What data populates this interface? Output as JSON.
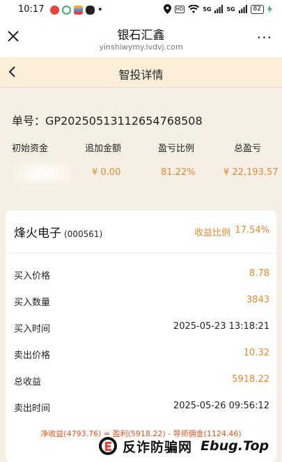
{
  "status_bar": {
    "time": "10:17",
    "network_badge": "HD",
    "signal_1": "5G",
    "signal_2": "5G",
    "battery": "82",
    "dot": "•"
  },
  "browser": {
    "title": "银石汇鑫",
    "url": "yinshiwymy.lvdvj.com",
    "more": "···"
  },
  "header": {
    "title": "智投详情"
  },
  "summary": {
    "order_label": "单号：",
    "order_no": "GP20250513112654768508",
    "headers": [
      "初始资金",
      "追加金额",
      "盈亏比例",
      "总盈亏"
    ],
    "values": {
      "initial": "",
      "added": "¥ 0.00",
      "pl_ratio": "81.22%",
      "total_pl": "¥ 22,193.57"
    }
  },
  "card": {
    "stock_name": "烽火电子",
    "stock_code": "(000561)",
    "yield_label": "收益比例",
    "yield_value": "17.54%",
    "rows": [
      {
        "label": "买入价格",
        "value": "8.78"
      },
      {
        "label": "买入数量",
        "value": "3843"
      },
      {
        "label": "买入时间",
        "value": "2025-05-23 13:18:21"
      },
      {
        "label": "卖出价格",
        "value": "10.32"
      },
      {
        "label": "总收益",
        "value": "5918.22"
      },
      {
        "label": "卖出时间",
        "value": "2025-05-26 09:56:12"
      }
    ],
    "net_line": "净收益(4793.76) = 盈利(5918.22) - 导师佣金(1124.46)"
  },
  "watermark": {
    "text": "反诈防骗网",
    "site": "Ebug.Top"
  },
  "colors": {
    "accent_orange": "#e08a2e",
    "header_bg": "#fbefd9",
    "page_bg": "#f5efe6",
    "net_red": "#e0521f"
  }
}
